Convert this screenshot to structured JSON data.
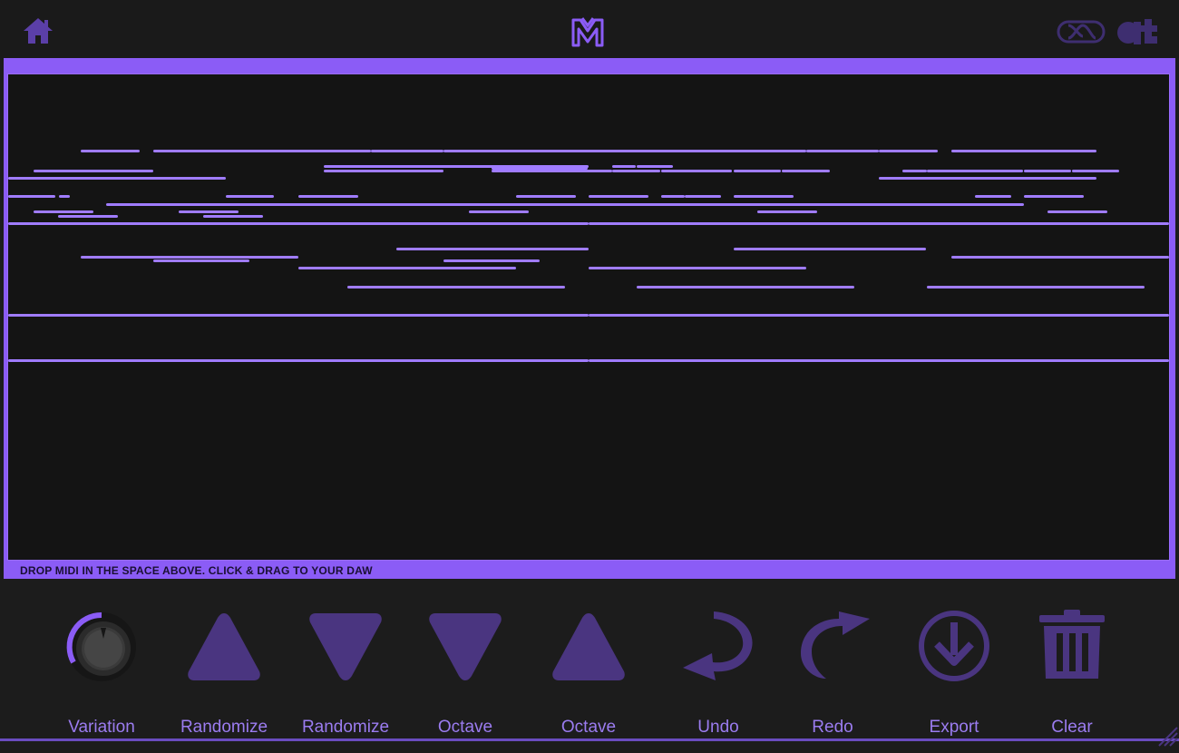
{
  "header": {
    "home_icon": "home-icon",
    "logo_icon": "m-logo-icon",
    "link_icon": "infinity-link-icon",
    "brand_icon": "at-brand-icon"
  },
  "colors": {
    "accent": "#8b5cf6",
    "note": "#a07cff",
    "button_fill": "#4a3580",
    "background": "#1c1c1c",
    "roll_background": "#141414"
  },
  "piano_roll": {
    "hint": "DROP MIDI IN THE SPACE ABOVE. CLICK & DRAG TO YOUR DAW"
  },
  "controls": [
    {
      "id": "variation",
      "label": "Variation",
      "icon": "knob-icon",
      "value": 0.25
    },
    {
      "id": "randomize-up",
      "label": "Randomize",
      "icon": "triangle-up-icon"
    },
    {
      "id": "randomize-down",
      "label": "Randomize",
      "icon": "triangle-down-icon"
    },
    {
      "id": "octave-down",
      "label": "Octave",
      "icon": "triangle-down-icon"
    },
    {
      "id": "octave-up",
      "label": "Octave",
      "icon": "triangle-up-icon"
    },
    {
      "id": "undo",
      "label": "Undo",
      "icon": "undo-arrow-icon"
    },
    {
      "id": "redo",
      "label": "Redo",
      "icon": "redo-arrow-icon"
    },
    {
      "id": "export",
      "label": "Export",
      "icon": "download-icon"
    },
    {
      "id": "clear",
      "label": "Clear",
      "icon": "trash-icon"
    }
  ]
}
